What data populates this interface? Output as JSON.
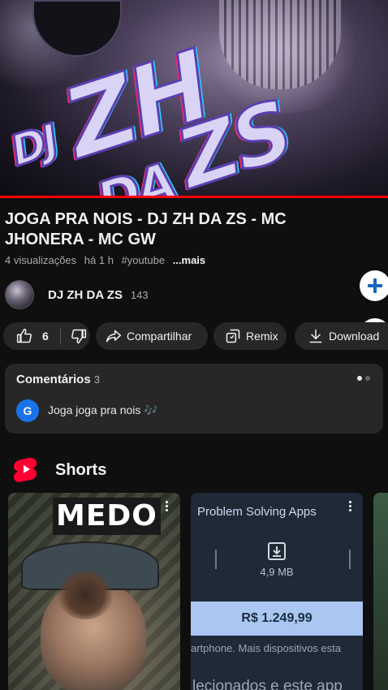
{
  "video": {
    "thumbnail_text": [
      "DJ",
      "ZH",
      "DA",
      "ZS"
    ],
    "progress_fraction": 1.0
  },
  "title": "JOGA PRA NOIS - DJ ZH DA ZS - MC JHONERA - MC GW",
  "meta": {
    "views": "4 visualizações",
    "age": "há 1 h",
    "hashtag": "#youtube",
    "more": "...mais"
  },
  "channel": {
    "name": "DJ ZH DA ZS",
    "subscribers": "143"
  },
  "zoom": {
    "plus_icon": "plus-icon",
    "minus_icon": "minus-icon"
  },
  "actions": {
    "like_count": "6",
    "share_label": "Compartilhar",
    "remix_label": "Remix",
    "download_label": "Download"
  },
  "comments": {
    "header": "Comentários",
    "count": "3",
    "avatar_letter": "G",
    "first_comment": "Joga joga pra nois 🎶"
  },
  "shorts": {
    "title": "Shorts",
    "items": [
      {
        "overlay_text": "MEDO"
      },
      {
        "ad_title": "Problem Solving Apps",
        "file_size": "4,9 MB",
        "price": "R$ 1.249,99",
        "description": "artphone. Mais dispositivos esta",
        "description_2": "lecionados e este app"
      }
    ]
  },
  "colors": {
    "background": "#0f0f0f",
    "chip": "#272727",
    "accent_red": "#ff0000",
    "zoom_icon": "#1565c0"
  }
}
